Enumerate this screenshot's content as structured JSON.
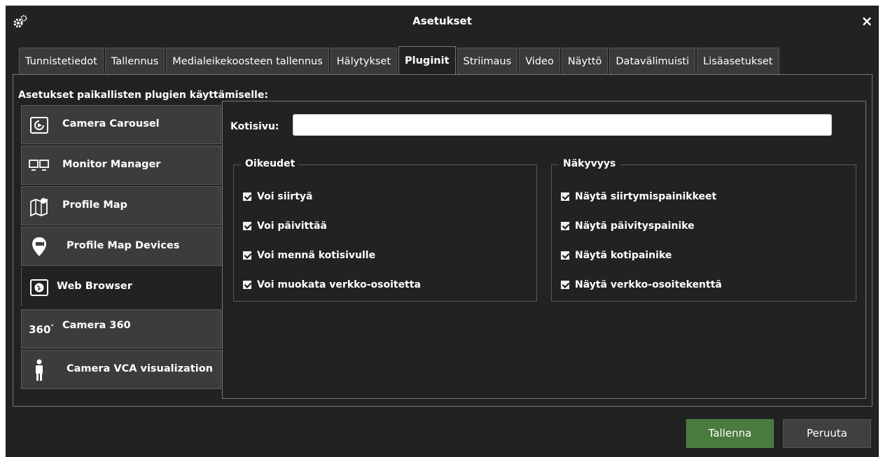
{
  "window": {
    "title": "Asetukset",
    "close_symbol": "×"
  },
  "tabs": [
    {
      "label": "Tunnistetiedot",
      "active": false
    },
    {
      "label": "Tallennus",
      "active": false
    },
    {
      "label": "Medialeikekoosteen tallennus",
      "active": false
    },
    {
      "label": "Hälytykset",
      "active": false
    },
    {
      "label": "Pluginit",
      "active": true
    },
    {
      "label": "Striimaus",
      "active": false
    },
    {
      "label": "Video",
      "active": false
    },
    {
      "label": "Näyttö",
      "active": false
    },
    {
      "label": "Datavälimuisti",
      "active": false
    },
    {
      "label": "Lisäasetukset",
      "active": false
    }
  ],
  "panel": {
    "heading": "Asetukset paikallisten plugien käyttämiselle:"
  },
  "plugins": [
    {
      "label": "Camera Carousel",
      "icon": "carousel-icon",
      "active": false
    },
    {
      "label": "Monitor Manager",
      "icon": "monitors-icon",
      "active": false
    },
    {
      "label": "Profile Map",
      "icon": "map-pin-icon",
      "active": false
    },
    {
      "label": "Profile Map Devices",
      "icon": "location-pin-icon",
      "active": false
    },
    {
      "label": "Web Browser",
      "icon": "globe-icon",
      "active": true
    },
    {
      "label": "Camera 360",
      "icon": "camera-360-icon",
      "active": false
    },
    {
      "label": "Camera VCA visualization",
      "icon": "person-icon",
      "active": false
    }
  ],
  "settings": {
    "home_label": "Kotisivu:",
    "home_value": "",
    "rights": {
      "legend": "Oikeudet",
      "items": [
        {
          "label": "Voi siirtyä",
          "checked": true
        },
        {
          "label": "Voi päivittää",
          "checked": true
        },
        {
          "label": "Voi mennä kotisivulle",
          "checked": true
        },
        {
          "label": "Voi muokata verkko-osoitetta",
          "checked": true
        }
      ]
    },
    "visibility": {
      "legend": "Näkyvyys",
      "items": [
        {
          "label": "Näytä siirtymispainikkeet",
          "checked": true
        },
        {
          "label": "Näytä päivityspainike",
          "checked": true
        },
        {
          "label": "Näytä kotipainike",
          "checked": true
        },
        {
          "label": "Näytä verkko-osoitekenttä",
          "checked": true
        }
      ]
    }
  },
  "footer": {
    "save_label": "Tallenna",
    "cancel_label": "Peruuta"
  },
  "colors": {
    "background": "#222222",
    "save_button": "#4a7a3e",
    "tab_inactive": "#3a3a3a"
  }
}
